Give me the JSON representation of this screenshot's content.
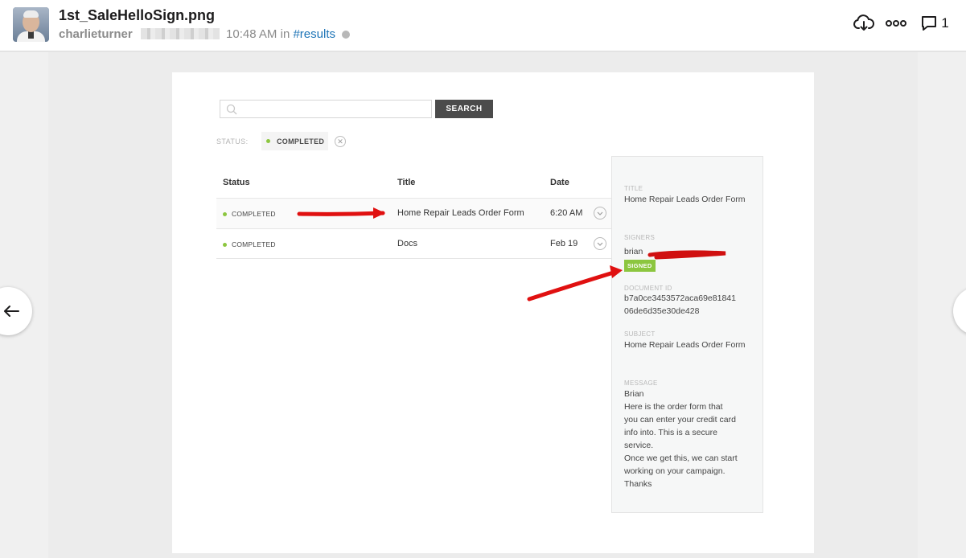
{
  "header": {
    "file_name": "1st_SaleHelloSign.png",
    "username": "charlieturner",
    "time": "10:48 AM",
    "in_label": "in",
    "channel": "#results",
    "comment_count": "1",
    "icons": {
      "download": "cloud-download-icon",
      "more": "more-options-icon",
      "comment": "comment-icon"
    }
  },
  "viewer": {
    "nav_prev_icon": "arrow-left-icon"
  },
  "document": {
    "search": {
      "placeholder": "",
      "button_label": "SEARCH"
    },
    "filter": {
      "label": "STATUS:",
      "chip_label": "COMPLETED"
    },
    "table": {
      "headers": [
        "Status",
        "Title",
        "Date"
      ],
      "rows": [
        {
          "status": "COMPLETED",
          "title": "Home Repair Leads Order Form",
          "date": "6:20 AM"
        },
        {
          "status": "COMPLETED",
          "title": "Docs",
          "date": "Feb 19"
        }
      ]
    },
    "details": {
      "title_label": "TITLE",
      "title_value": "Home Repair Leads Order Form",
      "signers_label": "SIGNERS",
      "signer_name": "brian",
      "signed_badge": "SIGNED",
      "document_id_label": "DOCUMENT ID",
      "document_id_value": "b7a0ce3453572aca69e81841 06de6d35e30de428",
      "subject_label": "SUBJECT",
      "subject_value": "Home Repair Leads Order Form",
      "message_label": "MESSAGE",
      "message_lines": [
        "Brian",
        "Here is the order form that",
        "you can enter your credit card",
        "info into. This is a secure",
        "service.",
        "Once we get this, we can start",
        "working on your campaign.",
        "Thanks"
      ]
    },
    "colors": {
      "status_green": "#8cc63f",
      "annotation_red": "#e01010",
      "channel_link": "#1d74b7"
    }
  }
}
